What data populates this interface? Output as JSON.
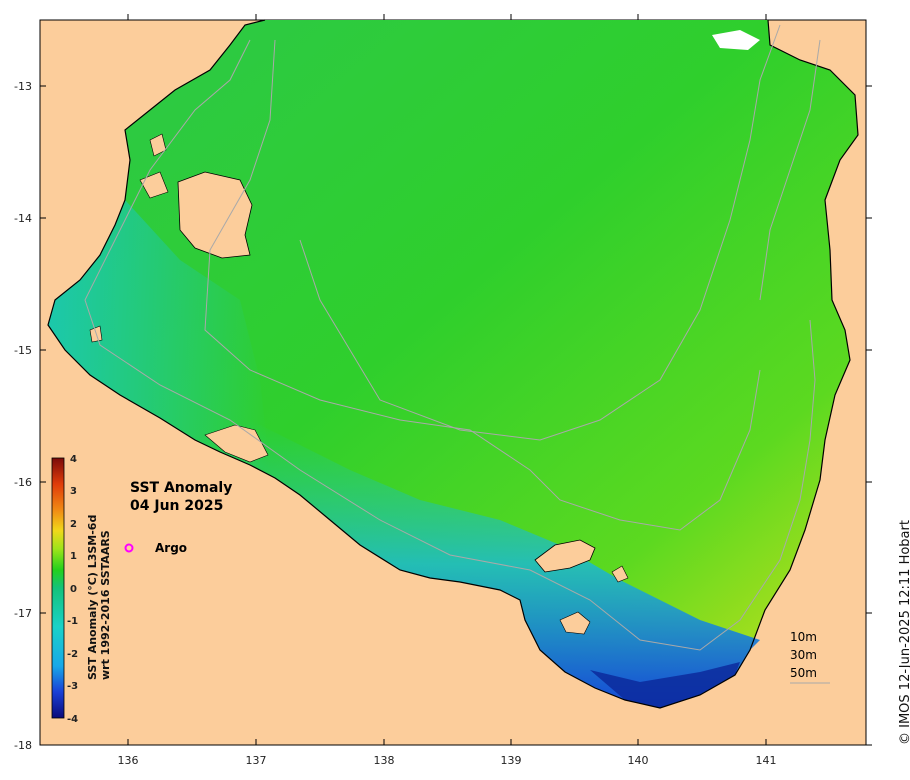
{
  "map": {
    "title": "SST Anomaly",
    "date": "04 Jun 2025",
    "lon_ticks": [
      "136",
      "137",
      "138",
      "139",
      "140",
      "141"
    ],
    "lat_ticks": [
      "-13",
      "-14",
      "-15",
      "-16",
      "-17",
      "-18"
    ],
    "land_color": "#fccd9b",
    "legend_item": "Argo",
    "argo_marker_color": "#ff00ff",
    "depth_labels": [
      "10m",
      "30m",
      "50m"
    ],
    "contour_color": "#a9a9a9"
  },
  "colorbar": {
    "label_line1": "SST Anomaly (°C) L3SM-6d",
    "label_line2": "wrt 1992-2016 SSTAARS",
    "ticks": [
      "4",
      "3",
      "2",
      "1",
      "0",
      "-1",
      "-2",
      "-3",
      "-4"
    ],
    "range": [
      -4,
      4
    ],
    "colors": [
      "#0a0a7a",
      "#1a3fd6",
      "#18a8e8",
      "#1ad2c8",
      "#14c27a",
      "#24d01c",
      "#9ee41a",
      "#f0d81a",
      "#f08a14",
      "#e03c0a",
      "#7a0a0a"
    ]
  },
  "credit": "© IMOS 12-Jun-2025 12:11 Hobart"
}
